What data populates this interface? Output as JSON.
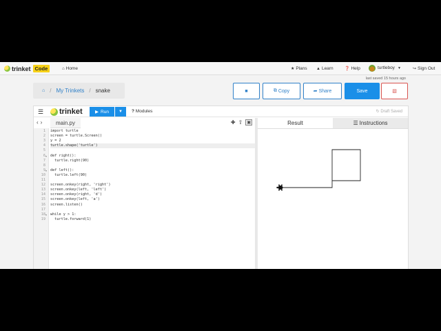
{
  "nav": {
    "logo_text": "trinket",
    "logo_badge": "Code",
    "home": "Home",
    "plans": "Plans",
    "learn": "Learn",
    "help": "Help",
    "user": "turtleboy",
    "signout": "Sign Out",
    "last_saved": "last saved 15 hours ago"
  },
  "breadcrumb": {
    "my_trinkets": "My Trinkets",
    "current": "snake"
  },
  "actions": {
    "copy": "Copy",
    "share": "Share",
    "save": "Save"
  },
  "toolbar": {
    "brand": "trinket",
    "run": "Run",
    "modules": "Modules",
    "draft": "Draft Saved"
  },
  "file": {
    "name": "main.py"
  },
  "code_lines": [
    "import turtle",
    "screen = turtle.Screen()",
    "y = 2",
    "turtle.shape('turtle')",
    "",
    "def right():",
    "  turtle.right(90)",
    "",
    "def left():",
    "  turtle.left(90)",
    "",
    "screen.onkey(right, 'right')",
    "screen.onkey(left, 'left')",
    "screen.onkey(right, 'd')",
    "screen.onkey(left, 'a')",
    "screen.listen()",
    "",
    "while y > 1:",
    "  turtle.forward(1)"
  ],
  "line_numbers": [
    "1",
    "2",
    "3",
    "4",
    "5",
    "6",
    "7",
    "8",
    "9",
    "10",
    "11",
    "12",
    "13",
    "14",
    "15",
    "16",
    "17",
    "18",
    "19"
  ],
  "output_tabs": {
    "result": "Result",
    "instructions": "Instructions"
  },
  "colors": {
    "accent": "#1a8fe8",
    "danger": "#d9534f",
    "logo_badge": "#f7d117"
  }
}
